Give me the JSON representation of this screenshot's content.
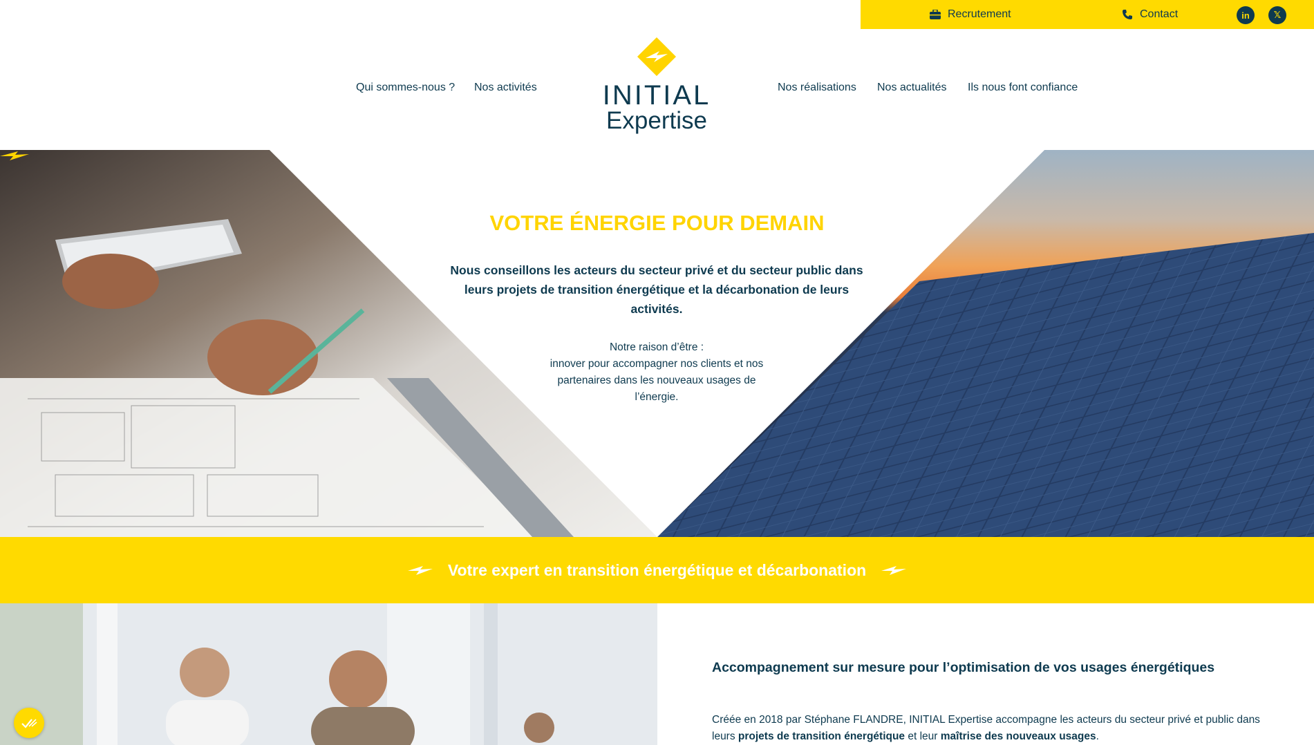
{
  "topbar": {
    "recruitment_label": "Recrutement",
    "contact_label": "Contact",
    "linkedin_icon": "linkedin-icon",
    "x_icon": "x-twitter-icon"
  },
  "nav": {
    "left": [
      "Qui sommes-nous ?",
      "Nos activités"
    ],
    "right": [
      "Nos réalisations",
      "Nos actualités",
      "Ils nous font confiance"
    ]
  },
  "logo": {
    "line1": "INITIAL",
    "line2": "Expertise"
  },
  "hero": {
    "title": "VOTRE ÉNERGIE POUR DEMAIN",
    "lead": "Nous conseillons les acteurs du secteur privé et du secteur public dans leurs projets de transition énergétique et la décarbonation de leurs activités.",
    "sub_line1": "Notre raison d’être :",
    "sub_line2": "innover pour accompagner nos clients et nos partenaires dans les nouveaux usages de l’énergie."
  },
  "band": {
    "title": "Votre expert en transition énergétique et décarbonation"
  },
  "about": {
    "title": "Accompagnement sur mesure pour l’optimisation de vos usages énergétiques",
    "text_a": "Créée en 2018 par Stéphane FLANDRE, INITIAL Expertise accompagne les acteurs du secteur privé et public dans leurs ",
    "text_b": "projets de transition énergétique",
    "text_c": " et leur ",
    "text_d": "maîtrise des nouveaux usages",
    "text_e": "."
  },
  "colors": {
    "brand_yellow": "#ffda00",
    "brand_navy": "#0e3a4f"
  }
}
